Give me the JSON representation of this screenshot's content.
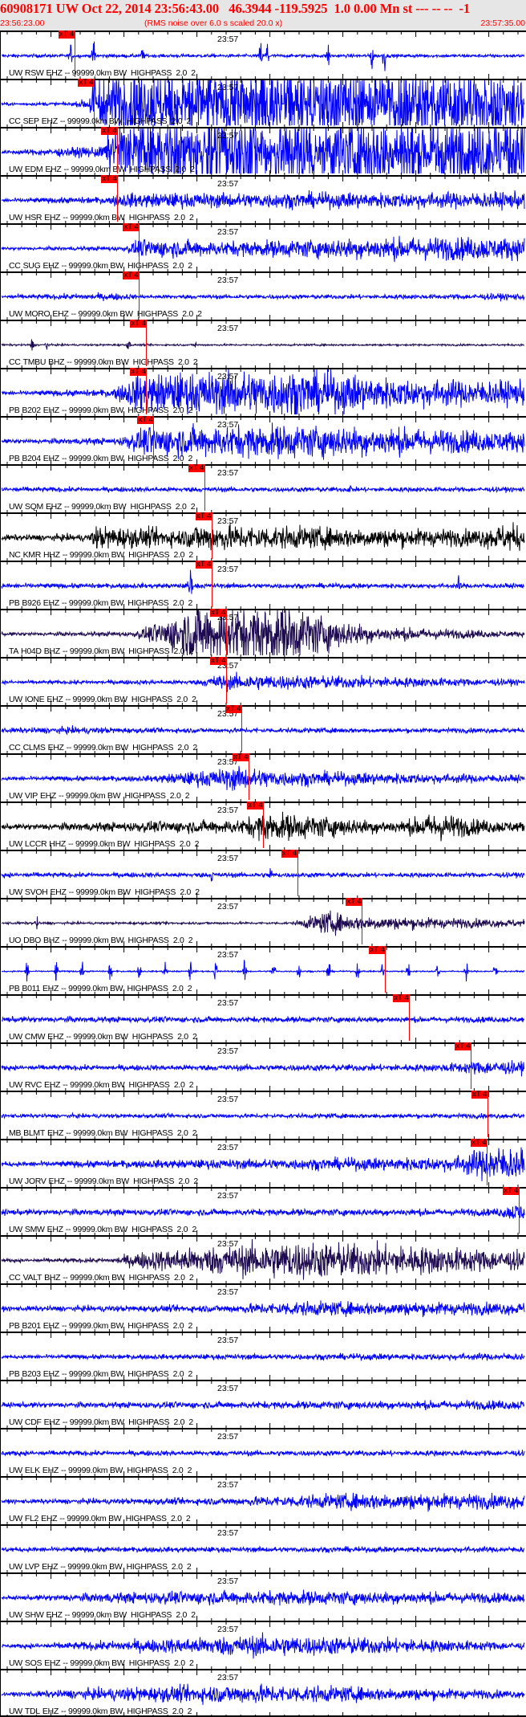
{
  "header": {
    "title": "60908171 UW Oct 22, 2014 23:56:43.00   46.3944 -119.5925  1.0 0.00 Mn st --- -- --  -1",
    "start_time": "23:56:23.00",
    "rms_note": "(RMS noise over 6.0 s scaled 20.0 x)",
    "end_time": "23:57:35.00"
  },
  "window_seconds": 72,
  "minute_label": "23:57",
  "filter_text": "-- 99999.0km BW  HIGHPASS  2.0  2",
  "pick_label": "xT 4",
  "colors": {
    "EHZ": "#0000ff",
    "HHZ": "#000000",
    "BHZ": "#1e0a50",
    "pick": "#ff0000",
    "title": "#ff0000",
    "header_bg": "#e6e6e6"
  },
  "stations": [
    {
      "net": "UW",
      "sta": "RSW",
      "chan": "EHZ",
      "pick_s": 10.0,
      "env": [
        [
          0,
          0.07
        ],
        [
          72,
          0.07
        ]
      ],
      "spikes": [
        [
          9.5,
          0.6
        ],
        [
          12.7,
          0.9
        ],
        [
          19.4,
          0.5
        ],
        [
          35.7,
          0.8
        ],
        [
          36.6,
          1.0
        ],
        [
          45,
          0.7
        ],
        [
          51,
          0.8
        ],
        [
          52.7,
          0.9
        ]
      ]
    },
    {
      "net": "CC",
      "sta": "SEP",
      "chan": "EHZ",
      "pick_s": 12.7,
      "env": [
        [
          0,
          0.06
        ],
        [
          10,
          0.08
        ],
        [
          12,
          0.25
        ],
        [
          12.8,
          1.6
        ],
        [
          72,
          1.6
        ]
      ],
      "spikes": []
    },
    {
      "net": "UW",
      "sta": "EDM",
      "chan": "EHZ",
      "pick_s": 15.9,
      "env": [
        [
          0,
          0.07
        ],
        [
          14,
          0.25
        ],
        [
          15.9,
          1.6
        ],
        [
          72,
          1.6
        ]
      ],
      "spikes": []
    },
    {
      "net": "UW",
      "sta": "HSR",
      "chan": "EHZ",
      "pick_s": 15.9,
      "env": [
        [
          0,
          0.08
        ],
        [
          15,
          0.15
        ],
        [
          16,
          0.3
        ],
        [
          72,
          0.35
        ]
      ],
      "spikes": [
        [
          8,
          0.3
        ]
      ]
    },
    {
      "net": "CC",
      "sta": "SUG",
      "chan": "EHZ",
      "pick_s": 18.9,
      "env": [
        [
          0,
          0.06
        ],
        [
          17,
          0.1
        ],
        [
          19,
          0.4
        ],
        [
          30,
          0.3
        ],
        [
          60,
          0.5
        ],
        [
          72,
          0.45
        ]
      ],
      "spikes": []
    },
    {
      "net": "UW",
      "sta": "MORO",
      "chan": "EHZ",
      "pick_s": 18.9,
      "env": [
        [
          0,
          0.08
        ],
        [
          16,
          0.15
        ],
        [
          19,
          0.08
        ],
        [
          60,
          0.1
        ],
        [
          72,
          0.15
        ]
      ],
      "spikes": []
    },
    {
      "net": "CC",
      "sta": "TMBU",
      "chan": "BHZ",
      "pick_s": 19.9,
      "env": [
        [
          0,
          0.04
        ],
        [
          72,
          0.04
        ]
      ],
      "spikes": [
        [
          4.2,
          0.4
        ],
        [
          6.2,
          0.3
        ],
        [
          17.5,
          0.35
        ],
        [
          26.7,
          0.2
        ]
      ]
    },
    {
      "net": "PB",
      "sta": "B202",
      "chan": "EHZ",
      "pick_s": 19.9,
      "env": [
        [
          0,
          0.08
        ],
        [
          15,
          0.15
        ],
        [
          19,
          0.8
        ],
        [
          40,
          1.0
        ],
        [
          55,
          0.6
        ],
        [
          72,
          0.5
        ]
      ],
      "spikes": []
    },
    {
      "net": "PB",
      "sta": "B204",
      "chan": "EHZ",
      "pick_s": 20.9,
      "env": [
        [
          0,
          0.08
        ],
        [
          16,
          0.15
        ],
        [
          20,
          0.6
        ],
        [
          40,
          0.7
        ],
        [
          72,
          0.4
        ]
      ],
      "spikes": []
    },
    {
      "net": "UW",
      "sta": "SQM",
      "chan": "EHZ",
      "pick_s": 27.9,
      "env": [
        [
          0,
          0.1
        ],
        [
          72,
          0.1
        ]
      ],
      "spikes": [
        [
          48,
          0.35
        ]
      ]
    },
    {
      "net": "NC",
      "sta": "KMR",
      "chan": "HHZ",
      "pick_s": 28.9,
      "env": [
        [
          0,
          0.12
        ],
        [
          12,
          0.15
        ],
        [
          13,
          0.5
        ],
        [
          20,
          0.4
        ],
        [
          25,
          0.35
        ],
        [
          27,
          0.6
        ],
        [
          35,
          0.5
        ],
        [
          50,
          0.4
        ],
        [
          65,
          0.35
        ],
        [
          70,
          0.6
        ],
        [
          72,
          0.5
        ]
      ],
      "spikes": []
    },
    {
      "net": "PB",
      "sta": "B926",
      "chan": "EHZ",
      "pick_s": 28.9,
      "env": [
        [
          0,
          0.1
        ],
        [
          72,
          0.1
        ]
      ],
      "spikes": [
        [
          25.9,
          1.2
        ],
        [
          26.0,
          1.2
        ],
        [
          63,
          0.5
        ]
      ]
    },
    {
      "net": "TA",
      "sta": "H04D",
      "chan": "BHZ",
      "pick_s": 30.9,
      "env": [
        [
          0,
          0.07
        ],
        [
          18,
          0.1
        ],
        [
          22,
          0.5
        ],
        [
          26,
          1.2
        ],
        [
          40,
          1.2
        ],
        [
          46,
          0.6
        ],
        [
          52,
          0.3
        ],
        [
          72,
          0.1
        ]
      ],
      "spikes": []
    },
    {
      "net": "UW",
      "sta": "IONE",
      "chan": "EHZ",
      "pick_s": 30.9,
      "env": [
        [
          0,
          0.07
        ],
        [
          27,
          0.1
        ],
        [
          30,
          0.35
        ],
        [
          40,
          0.3
        ],
        [
          72,
          0.12
        ]
      ],
      "spikes": []
    },
    {
      "net": "CC",
      "sta": "CLMS",
      "chan": "EHZ",
      "pick_s": 33.0,
      "env": [
        [
          0,
          0.1
        ],
        [
          10,
          0.15
        ],
        [
          20,
          0.1
        ],
        [
          72,
          0.1
        ]
      ],
      "spikes": []
    },
    {
      "net": "UW",
      "sta": "VIP",
      "chan": "EHZ",
      "pick_s": 34.0,
      "env": [
        [
          0,
          0.08
        ],
        [
          20,
          0.12
        ],
        [
          30,
          0.4
        ],
        [
          32,
          0.5
        ],
        [
          40,
          0.3
        ],
        [
          72,
          0.15
        ]
      ],
      "spikes": []
    },
    {
      "net": "UW",
      "sta": "LCCR",
      "chan": "HHZ",
      "pick_s": 36.0,
      "env": [
        [
          0,
          0.1
        ],
        [
          33,
          0.3
        ],
        [
          36,
          0.6
        ],
        [
          42,
          0.5
        ],
        [
          50,
          0.3
        ],
        [
          55,
          0.25
        ],
        [
          60,
          0.6
        ],
        [
          66,
          0.3
        ],
        [
          72,
          0.2
        ]
      ],
      "spikes": []
    },
    {
      "net": "UW",
      "sta": "SVOH",
      "chan": "EHZ",
      "pick_s": 40.7,
      "env": [
        [
          0,
          0.1
        ],
        [
          72,
          0.1
        ]
      ],
      "spikes": [
        [
          29,
          0.5
        ],
        [
          37,
          0.6
        ]
      ]
    },
    {
      "net": "UO",
      "sta": "DBO",
      "chan": "BHZ",
      "pick_s": 49.6,
      "env": [
        [
          0,
          0.05
        ],
        [
          40,
          0.05
        ],
        [
          45,
          0.5
        ],
        [
          48,
          0.3
        ],
        [
          72,
          0.15
        ]
      ],
      "spikes": [
        [
          4.8,
          0.4
        ]
      ]
    },
    {
      "net": "PB",
      "sta": "B011",
      "chan": "EHZ",
      "pick_s": 52.8,
      "env": [
        [
          0,
          0.03
        ],
        [
          72,
          0.03
        ]
      ],
      "spikes": [
        [
          3.5,
          0.6
        ],
        [
          7.5,
          0.6
        ],
        [
          11,
          0.6
        ],
        [
          15,
          0.6
        ],
        [
          19,
          0.6
        ],
        [
          22.5,
          0.6
        ],
        [
          26,
          0.6
        ],
        [
          29.5,
          0.6
        ],
        [
          33.5,
          0.6
        ],
        [
          37.5,
          0.6
        ],
        [
          41,
          0.6
        ],
        [
          45,
          0.6
        ],
        [
          49,
          0.6
        ],
        [
          52.5,
          0.6
        ],
        [
          56,
          0.6
        ],
        [
          60,
          0.6
        ],
        [
          64,
          0.6
        ],
        [
          68,
          0.6
        ]
      ]
    },
    {
      "net": "UW",
      "sta": "CMW",
      "chan": "EHZ",
      "pick_s": 56.1,
      "env": [
        [
          0,
          0.12
        ],
        [
          72,
          0.12
        ]
      ],
      "spikes": []
    },
    {
      "net": "UW",
      "sta": "RVC",
      "chan": "EHZ",
      "pick_s": 64.6,
      "env": [
        [
          0,
          0.1
        ],
        [
          60,
          0.15
        ],
        [
          66,
          0.3
        ],
        [
          72,
          0.25
        ]
      ],
      "spikes": []
    },
    {
      "net": "MB",
      "sta": "BLMT",
      "chan": "EHZ",
      "pick_s": 66.9,
      "env": [
        [
          0,
          0.08
        ],
        [
          72,
          0.1
        ]
      ],
      "spikes": []
    },
    {
      "net": "UW",
      "sta": "JORV",
      "chan": "EHZ",
      "pick_s": 66.8,
      "env": [
        [
          0,
          0.1
        ],
        [
          62,
          0.3
        ],
        [
          68,
          0.8
        ],
        [
          72,
          0.6
        ]
      ],
      "spikes": []
    },
    {
      "net": "UW",
      "sta": "SMW",
      "chan": "EHZ",
      "pick_s": 71.2,
      "env": [
        [
          0,
          0.12
        ],
        [
          68,
          0.15
        ],
        [
          71,
          0.4
        ],
        [
          72,
          0.3
        ]
      ],
      "spikes": []
    },
    {
      "net": "CC",
      "sta": "VALT",
      "chan": "BHZ",
      "pick_s": null,
      "env": [
        [
          0,
          0.07
        ],
        [
          15,
          0.1
        ],
        [
          20,
          0.4
        ],
        [
          30,
          0.6
        ],
        [
          40,
          0.8
        ],
        [
          50,
          0.7
        ],
        [
          72,
          0.4
        ]
      ],
      "spikes": []
    },
    {
      "net": "PB",
      "sta": "B201",
      "chan": "EHZ",
      "pick_s": null,
      "env": [
        [
          0,
          0.1
        ],
        [
          30,
          0.15
        ],
        [
          40,
          0.3
        ],
        [
          72,
          0.25
        ]
      ],
      "spikes": []
    },
    {
      "net": "PB",
      "sta": "B203",
      "chan": "EHZ",
      "pick_s": null,
      "env": [
        [
          0,
          0.08
        ],
        [
          72,
          0.15
        ]
      ],
      "spikes": []
    },
    {
      "net": "UW",
      "sta": "CDF",
      "chan": "EHZ",
      "pick_s": null,
      "env": [
        [
          0,
          0.1
        ],
        [
          72,
          0.2
        ]
      ],
      "spikes": []
    },
    {
      "net": "UW",
      "sta": "ELK",
      "chan": "EHZ",
      "pick_s": null,
      "env": [
        [
          0,
          0.1
        ],
        [
          72,
          0.12
        ]
      ],
      "spikes": []
    },
    {
      "net": "UW",
      "sta": "FL2",
      "chan": "EHZ",
      "pick_s": null,
      "env": [
        [
          0,
          0.08
        ],
        [
          30,
          0.15
        ],
        [
          50,
          0.35
        ],
        [
          72,
          0.3
        ]
      ],
      "spikes": []
    },
    {
      "net": "UW",
      "sta": "LVP",
      "chan": "EHZ",
      "pick_s": null,
      "env": [
        [
          0,
          0.1
        ],
        [
          72,
          0.12
        ]
      ],
      "spikes": []
    },
    {
      "net": "UW",
      "sta": "SHW",
      "chan": "EHZ",
      "pick_s": null,
      "env": [
        [
          0,
          0.06
        ],
        [
          20,
          0.25
        ],
        [
          40,
          0.3
        ],
        [
          72,
          0.2
        ]
      ],
      "spikes": []
    },
    {
      "net": "UW",
      "sta": "SOS",
      "chan": "EHZ",
      "pick_s": null,
      "env": [
        [
          0,
          0.07
        ],
        [
          15,
          0.2
        ],
        [
          35,
          0.45
        ],
        [
          50,
          0.35
        ],
        [
          72,
          0.15
        ]
      ],
      "spikes": []
    },
    {
      "net": "UW",
      "sta": "TDL",
      "chan": "EHZ",
      "pick_s": null,
      "env": [
        [
          0,
          0.06
        ],
        [
          18,
          0.3
        ],
        [
          35,
          0.4
        ],
        [
          72,
          0.15
        ]
      ],
      "spikes": []
    }
  ]
}
